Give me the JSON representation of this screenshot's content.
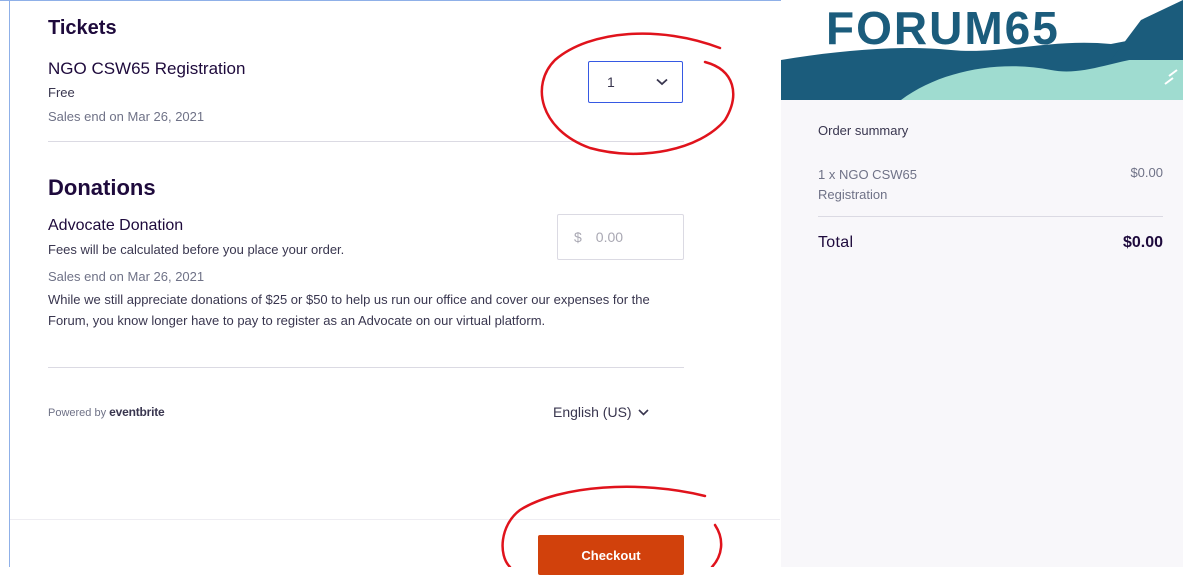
{
  "tickets": {
    "title": "Tickets",
    "item_name": "NGO CSW65 Registration",
    "price": "Free",
    "sales_end": "Sales end on Mar 26, 2021",
    "quantity_selected": "1"
  },
  "donations": {
    "title": "Donations",
    "item_name": "Advocate Donation",
    "fees_note": "Fees will be calculated before you place your order.",
    "currency_symbol": "$",
    "amount_placeholder": "0.00",
    "sales_end": "Sales end on Mar 26, 2021",
    "description": "While we still appreciate donations of $25 or $50 to help us run our office and cover our expenses for the Forum, you know longer have to pay to register as an Advocate on our virtual platform."
  },
  "footer": {
    "powered_by": "Powered by",
    "brand": "eventbrite",
    "language": "English (US)"
  },
  "checkout": {
    "label": "Checkout"
  },
  "sidebar": {
    "banner_text": "FORUM65",
    "summary_title": "Order summary",
    "line_item": "1 x NGO CSW65 Registration",
    "line_price": "$0.00",
    "total_label": "Total",
    "total_value": "$0.00"
  },
  "colors": {
    "accent_blue": "#3659e3",
    "checkout_orange": "#d1410c",
    "annotation_red": "#e0131c",
    "banner_dark": "#1b5c7c",
    "banner_teal": "#9fdcd0"
  }
}
